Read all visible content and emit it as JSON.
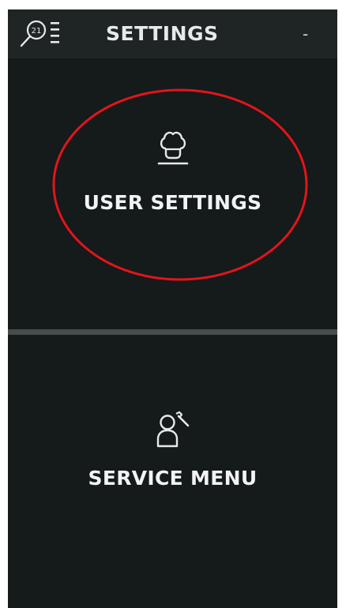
{
  "header": {
    "title": "SETTINGS",
    "extra": "-",
    "left_icon": "search-list-icon",
    "left_icon_digits": "21"
  },
  "menu": {
    "items": [
      {
        "label": "USER SETTINGS",
        "icon": "chef-hat-icon"
      },
      {
        "label": "SERVICE MENU",
        "icon": "technician-wrench-icon"
      }
    ]
  },
  "annotation": {
    "shape": "ellipse",
    "color": "#e3141c",
    "target": "USER SETTINGS"
  },
  "colors": {
    "background": "#151a1a",
    "topbar": "#1f2424",
    "divider": "#474c4c",
    "text": "#f2f4f4"
  }
}
